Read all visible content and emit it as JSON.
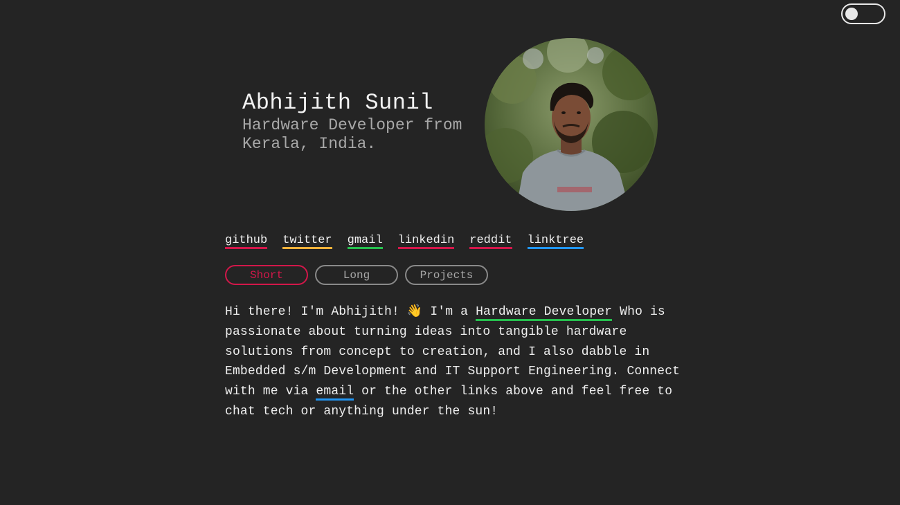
{
  "theme_toggle": {
    "icon": "toggle-switch",
    "state": "off"
  },
  "profile": {
    "name": "Abhijith Sunil",
    "subtitle": "Hardware Developer from Kerala, India.",
    "avatar": "profile-photo"
  },
  "links": [
    {
      "label": "github",
      "color": "#d3174a"
    },
    {
      "label": "twitter",
      "color": "#f0b23a"
    },
    {
      "label": "gmail",
      "color": "#26c04e"
    },
    {
      "label": "linkedin",
      "color": "#d3174a"
    },
    {
      "label": "reddit",
      "color": "#d3174a"
    },
    {
      "label": "linktree",
      "color": "#2196f3"
    }
  ],
  "tabs": [
    {
      "label": "Short",
      "active": true
    },
    {
      "label": "Long",
      "active": false
    },
    {
      "label": "Projects",
      "active": false
    }
  ],
  "bio": {
    "part1": "Hi there! I'm Abhijith! 👋 I'm a ",
    "link1": "Hardware Developer",
    "link1_color": "#26c04e",
    "part2": " Who is passionate about turning ideas into tangible hardware solutions from concept to creation, and I also dabble in Embedded s/m Development and IT Support Engineering. Connect with me via ",
    "link2": "email",
    "link2_color": "#2196f3",
    "part3": " or the other links above and feel free to chat tech or anything under the sun!"
  },
  "colors": {
    "background": "#242424",
    "accent": "#d3174a",
    "muted": "#a8a8a8"
  }
}
